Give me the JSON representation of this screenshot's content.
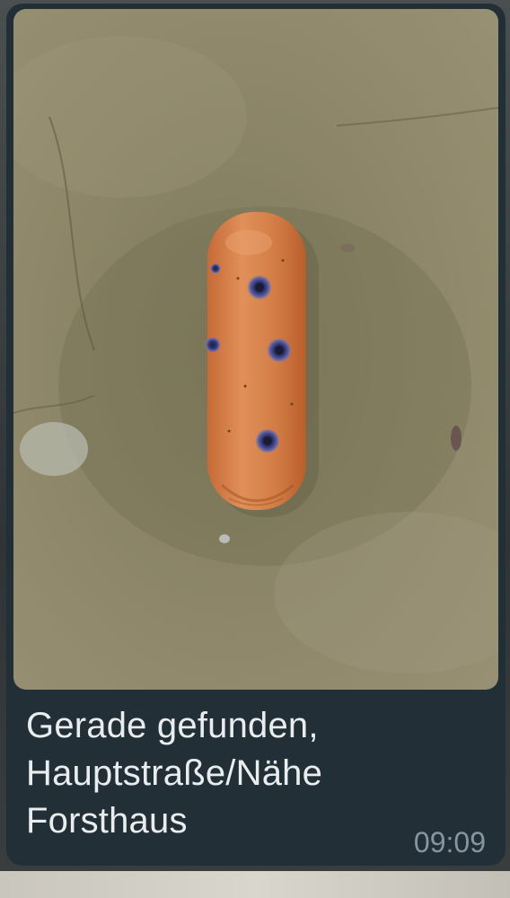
{
  "message": {
    "caption": "Gerade gefunden,\nHauptstraße/Nähe\nForsthaus",
    "time": "09:09",
    "photo": {
      "alt": "Wurst mit blauen Einstichen auf Steinboden"
    }
  },
  "colors": {
    "bubble": "#232f37",
    "caption_text": "#e9edef",
    "time_text": "#8696a0",
    "stone": "#8c8468",
    "sausage": "#d9844c",
    "puncture": "#4b4f8a"
  }
}
